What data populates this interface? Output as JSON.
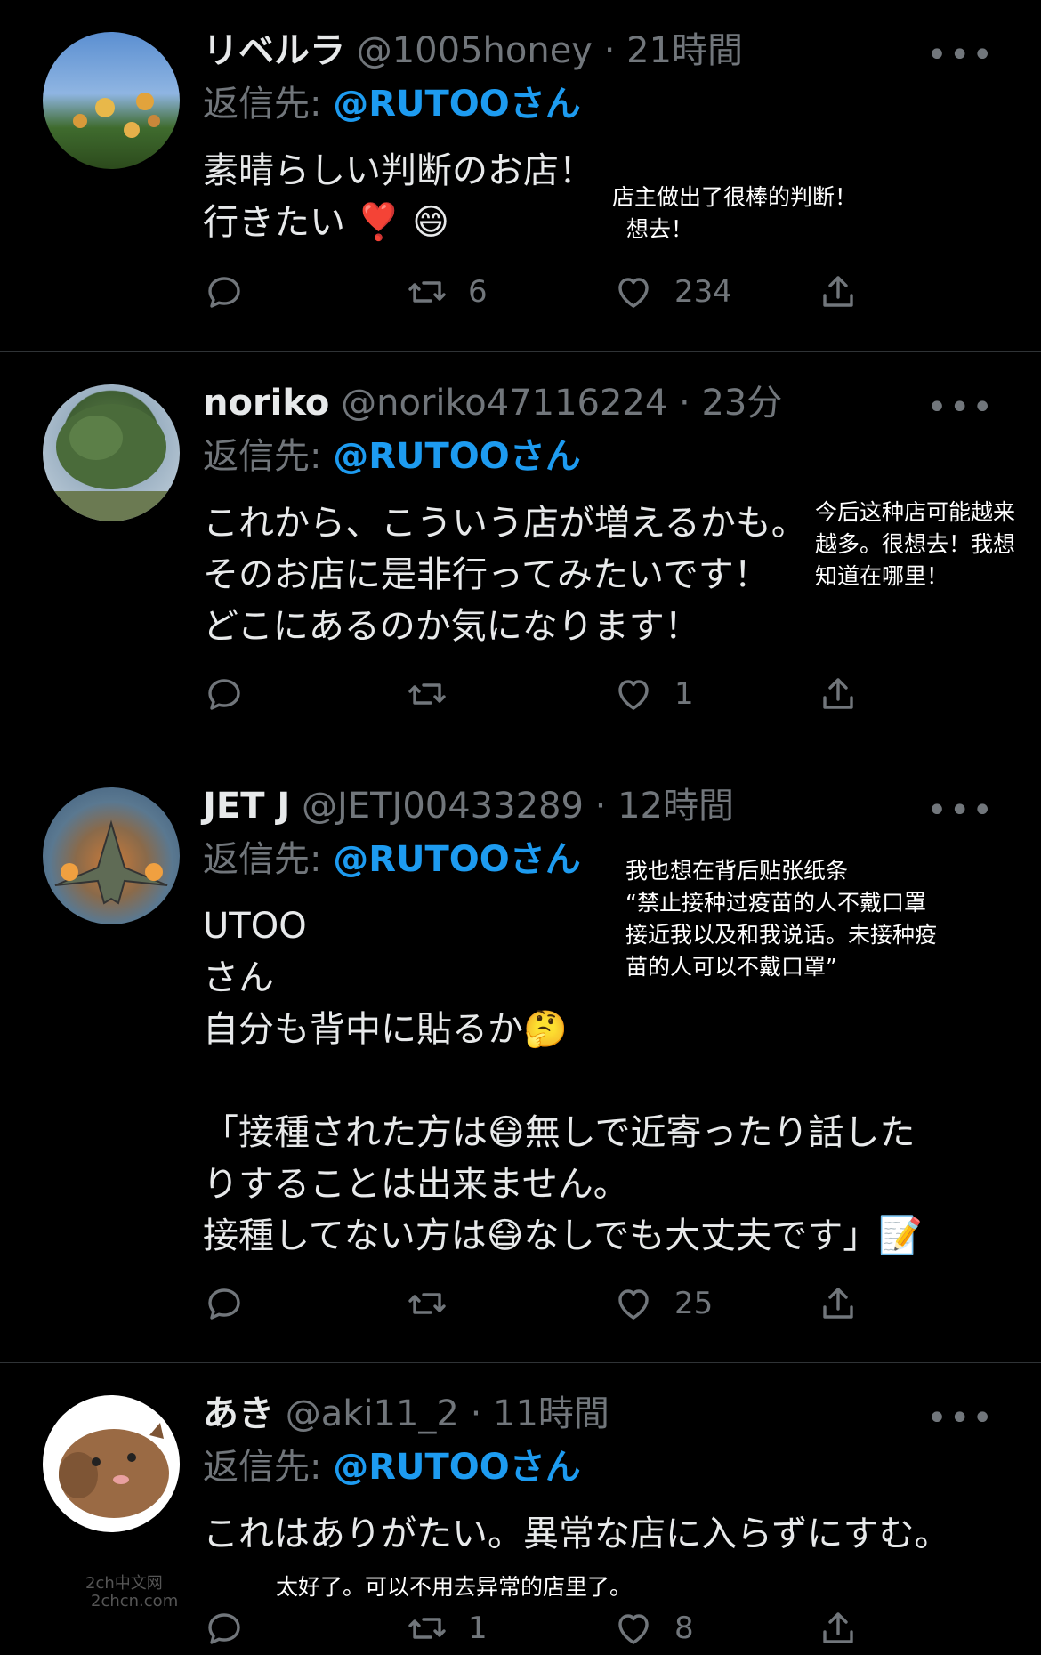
{
  "tweets": [
    {
      "name": "リベルラ",
      "handle": "@1005honey",
      "sep": "·",
      "time": "21時間",
      "reply_prefix": "返信先:",
      "reply_mention": "@RUTOOさん",
      "body": "素晴らしい判断のお店！\n行きたい ❣️ 😄",
      "reply_count": "",
      "retweet_count": "6",
      "like_count": "234",
      "note": "店主做出了很棒的判断！\n  想去！"
    },
    {
      "name": "noriko",
      "handle": "@noriko47116224",
      "sep": "·",
      "time": "23分",
      "reply_prefix": "返信先:",
      "reply_mention": "@RUTOOさん",
      "body": "これから、こういう店が増えるかも。\nそのお店に是非行ってみたいです！\nどこにあるのか気になります！",
      "reply_count": "",
      "retweet_count": "",
      "like_count": "1",
      "note": "今后这种店可能越来\n越多。很想去！我想\n知道在哪里！"
    },
    {
      "name": "JET J",
      "handle": "@JETJ00433289",
      "sep": "·",
      "time": "12時間",
      "reply_prefix": "返信先:",
      "reply_mention": "@RUTOOさん",
      "body": "UTOO\nさん\n自分も背中に貼るか🤔\n\n「接種された方は😷無しで近寄ったり話した\nりすることは出来ません。\n接種してない方は😷なしでも大丈夫です」📝",
      "reply_count": "",
      "retweet_count": "",
      "like_count": "25",
      "note": "我也想在背后贴张纸条\n“禁止接种过疫苗的人不戴口罩\n接近我以及和我说话。未接种疫\n苗的人可以不戴口罩”"
    },
    {
      "name": "あき",
      "handle": "@aki11_2",
      "sep": "·",
      "time": "11時間",
      "reply_prefix": "返信先:",
      "reply_mention": "@RUTOOさん",
      "body": "これはありがたい。異常な店に入らずにすむ。",
      "reply_count": "",
      "retweet_count": "1",
      "like_count": "8",
      "note": "太好了。可以不用去异常的店里了。"
    }
  ],
  "watermark": {
    "line1": "2ch中文网",
    "line2": "2chcn.com"
  },
  "more_icon": "ellipsis-icon",
  "colors": {
    "background": "#000000",
    "text": "#e7e9ea",
    "muted": "#71767b",
    "mention": "#1d9bf0"
  }
}
